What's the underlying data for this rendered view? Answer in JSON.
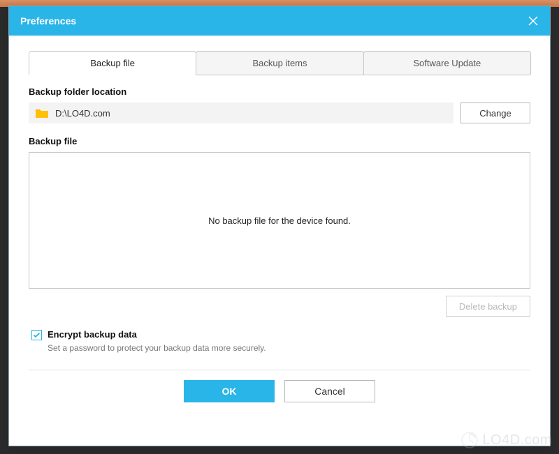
{
  "window": {
    "title": "Preferences"
  },
  "tabs": {
    "backup_file": "Backup file",
    "backup_items": "Backup items",
    "software_update": "Software Update"
  },
  "folder": {
    "label": "Backup folder location",
    "path": "D:\\LO4D.com",
    "change_btn": "Change"
  },
  "backup": {
    "label": "Backup file",
    "empty_message": "No backup file for the device found.",
    "delete_btn": "Delete backup"
  },
  "encrypt": {
    "checked": true,
    "label": "Encrypt backup data",
    "description": "Set a password to protect your backup data more securely."
  },
  "footer": {
    "ok": "OK",
    "cancel": "Cancel"
  },
  "watermark": {
    "text": "LO4D.com"
  }
}
